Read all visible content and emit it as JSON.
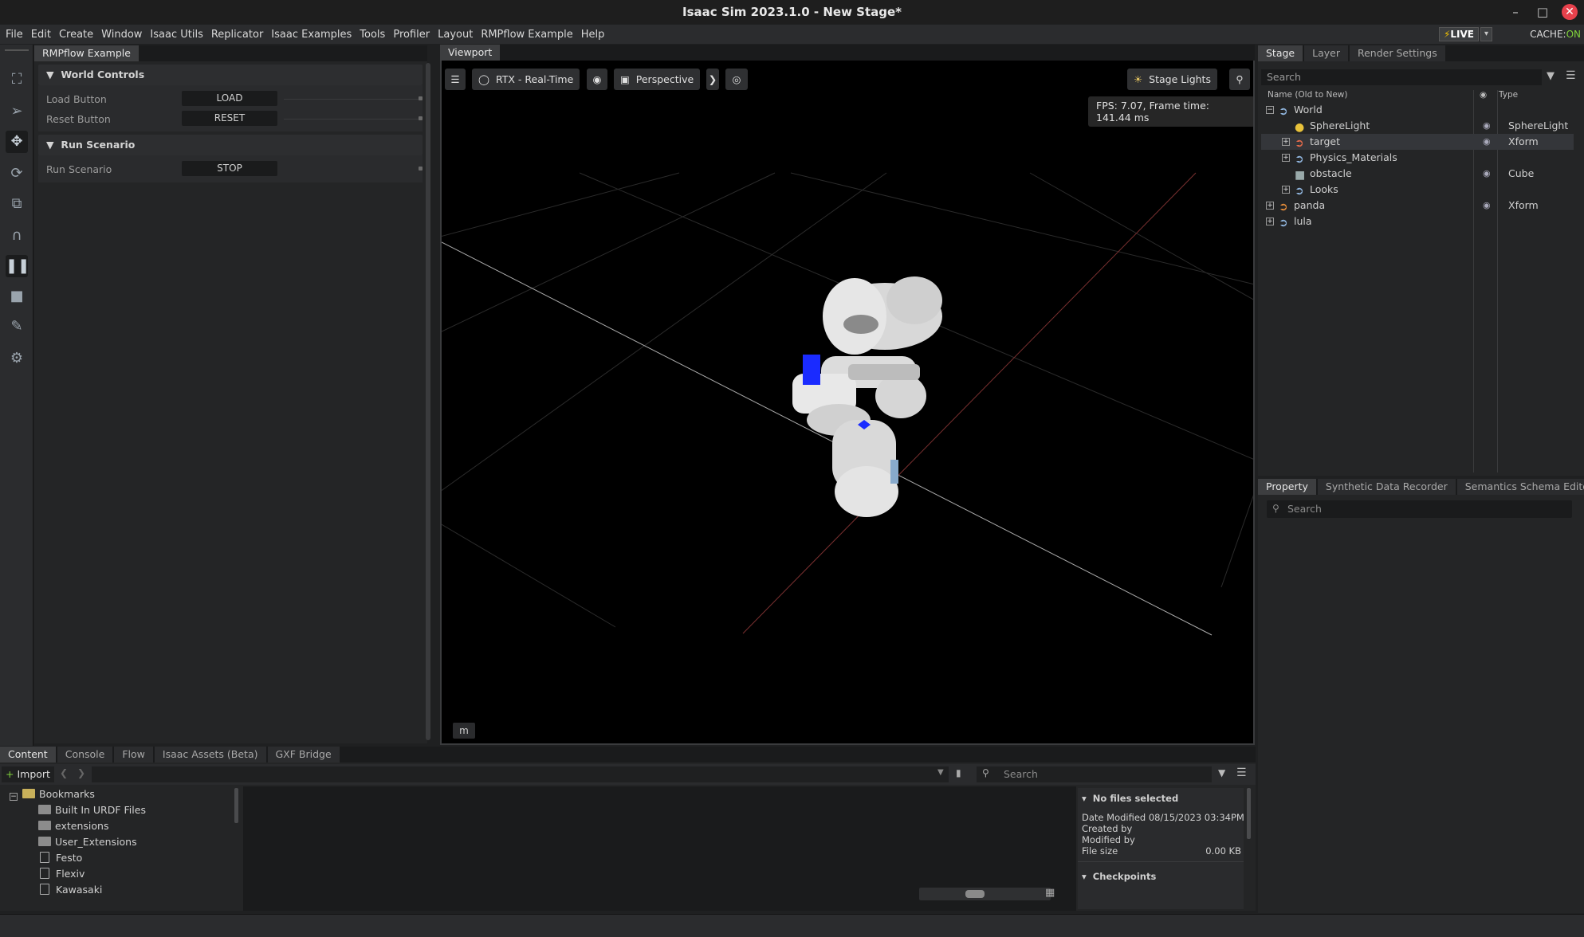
{
  "window": {
    "title": "Isaac Sim 2023.1.0 - New Stage*"
  },
  "menu": [
    "File",
    "Edit",
    "Create",
    "Window",
    "Isaac Utils",
    "Replicator",
    "Isaac Examples",
    "Tools",
    "Profiler",
    "Layout",
    "RMPflow Example",
    "Help"
  ],
  "live": {
    "label": "LIVE",
    "cache_label": "CACHE:",
    "cache_state": "ON"
  },
  "rmpflow": {
    "tab": "RMPflow Example",
    "world_controls": {
      "title": "World Controls",
      "load_label": "Load Button",
      "load_btn": "LOAD",
      "reset_label": "Reset Button",
      "reset_btn": "RESET"
    },
    "run_scenario": {
      "title": "Run Scenario",
      "run_label": "Run Scenario",
      "run_btn": "STOP"
    }
  },
  "viewport": {
    "tab": "Viewport",
    "renderer": "RTX - Real-Time",
    "camera": "Perspective",
    "lights": "Stage Lights",
    "fps": "FPS: 7.07, Frame time: 141.44 ms",
    "units": "m"
  },
  "stage": {
    "tabs": [
      "Stage",
      "Layer",
      "Render Settings"
    ],
    "search_placeholder": "Search",
    "col_name": "Name (Old to New)",
    "col_type": "Type",
    "rows": [
      {
        "name": "World",
        "type": ""
      },
      {
        "name": "SphereLight",
        "type": "SphereLight"
      },
      {
        "name": "target",
        "type": "Xform"
      },
      {
        "name": "Physics_Materials",
        "type": ""
      },
      {
        "name": "obstacle",
        "type": "Cube"
      },
      {
        "name": "Looks",
        "type": ""
      },
      {
        "name": "panda",
        "type": "Xform"
      },
      {
        "name": "lula",
        "type": ""
      }
    ]
  },
  "property": {
    "tabs": [
      "Property",
      "Synthetic Data Recorder",
      "Semantics Schema Editor"
    ],
    "search_placeholder": "Search"
  },
  "content": {
    "tabs": [
      "Content",
      "Console",
      "Flow",
      "Isaac Assets (Beta)",
      "GXF Bridge"
    ],
    "import_label": "Import",
    "search_placeholder": "Search",
    "folders": [
      "Bookmarks",
      "Built In URDF Files",
      "extensions",
      "User_Extensions",
      "Festo",
      "Flexiv",
      "Kawasaki"
    ],
    "info": {
      "no_files": "No files selected",
      "date_modified": "Date Modified 08/15/2023 03:34PM",
      "created_by": "Created by",
      "modified_by": "Modified by",
      "file_size_label": "File size",
      "file_size": "0.00 KB",
      "checkpoints": "Checkpoints"
    }
  },
  "colors": {
    "accent_live": "#f0c000",
    "cache_on": "#7fd13b",
    "close_button": "#e8414c",
    "grid_red": "#7a3030",
    "obstacle_blue": "#1a2bff"
  }
}
